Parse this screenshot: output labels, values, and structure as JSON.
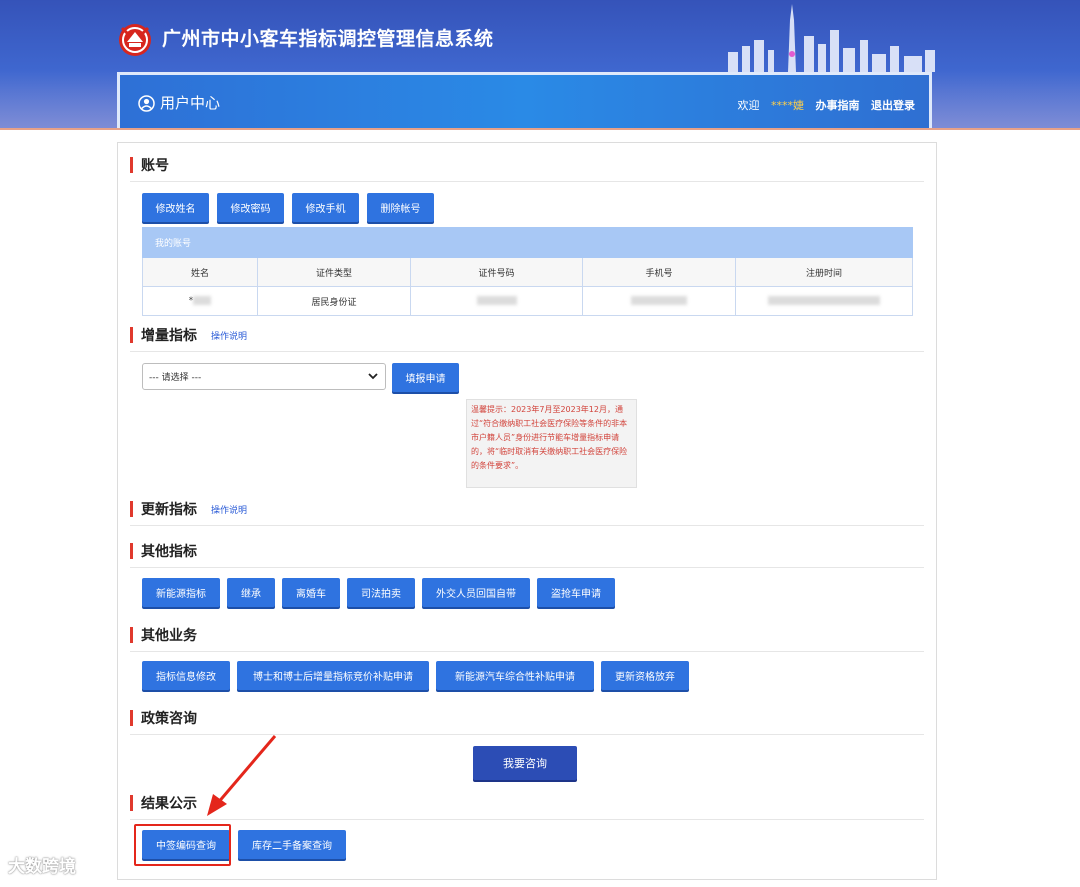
{
  "header": {
    "system_title": "广州市中小客车指标调控管理信息系统",
    "user_center": "用户中心",
    "welcome": "欢迎",
    "username": "****婕",
    "guide_link": "办事指南",
    "logout_link": "退出登录"
  },
  "account": {
    "section_title": "账号",
    "buttons": [
      "修改姓名",
      "修改密码",
      "修改手机",
      "删除帐号"
    ],
    "table_caption": "我的账号",
    "columns": [
      "姓名",
      "证件类型",
      "证件号码",
      "手机号",
      "注册时间"
    ],
    "row": {
      "name": "*",
      "id_type": "居民身份证"
    }
  },
  "increment": {
    "section_title": "增量指标",
    "help": "操作说明",
    "select_value": "--- 请选择 ---",
    "apply_button": "填报申请",
    "tip": "温馨提示：2023年7月至2023年12月，通过“符合缴纳职工社会医疗保险等条件的非本市户籍人员”身份进行节能车增量指标申请的，将“临时取消有关缴纳职工社会医疗保险的条件要求”。"
  },
  "renewal": {
    "section_title": "更新指标",
    "help": "操作说明"
  },
  "other_quota": {
    "section_title": "其他指标",
    "buttons": [
      "新能源指标",
      "继承",
      "离婚车",
      "司法拍卖",
      "外交人员回国自带",
      "盗抢车申请"
    ]
  },
  "other_business": {
    "section_title": "其他业务",
    "buttons": [
      "指标信息修改",
      "博士和博士后增量指标竞价补贴申请",
      "新能源汽车综合性补贴申请",
      "更新资格放弃"
    ]
  },
  "policy": {
    "section_title": "政策咨询",
    "consult_button": "我要咨询"
  },
  "results": {
    "section_title": "结果公示",
    "buttons": [
      "中签编码查询",
      "库存二手备案查询"
    ]
  },
  "watermark": "大数跨境",
  "colors": {
    "primary_button": "#2f73e0",
    "consult_button": "#2c4db5",
    "section_marker": "#e0392d",
    "highlight_box": "#e4261b",
    "tip_text": "#d2443c"
  }
}
